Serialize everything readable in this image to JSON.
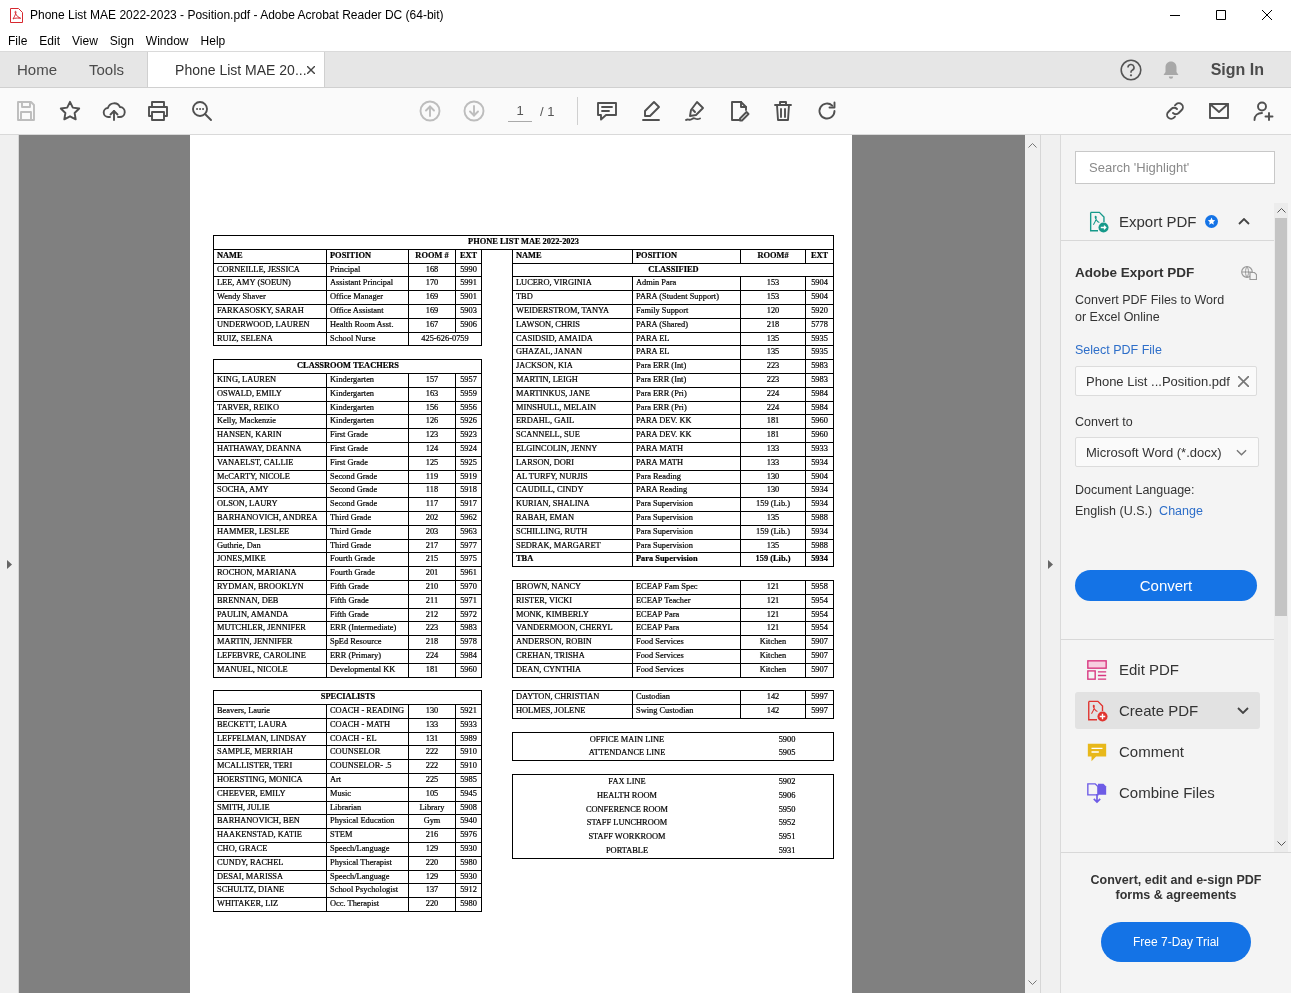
{
  "window": {
    "title": "Phone List MAE 2022-2023 - Position.pdf - Adobe Acrobat Reader DC (64-bit)"
  },
  "menu": [
    "File",
    "Edit",
    "View",
    "Sign",
    "Window",
    "Help"
  ],
  "tabs": [
    {
      "label": "Home",
      "kind": "nav",
      "selected": false
    },
    {
      "label": "Tools",
      "kind": "nav",
      "selected": false
    },
    {
      "label": "Phone List MAE 20...",
      "kind": "document",
      "selected": true
    }
  ],
  "account": {
    "label": "Sign In"
  },
  "toolbar": {
    "file_tools": [
      {
        "kind": "save",
        "disabled": true
      },
      {
        "kind": "star",
        "disabled": false
      },
      {
        "kind": "upload",
        "disabled": false
      },
      {
        "kind": "print",
        "disabled": false
      },
      {
        "kind": "zoom",
        "disabled": false
      }
    ],
    "page_nav": [
      {
        "kind": "up",
        "disabled": true
      },
      {
        "kind": "down",
        "disabled": true
      }
    ],
    "page_number": "1",
    "page_total": "/ 1",
    "edit_tools": [
      {
        "kind": "comment",
        "disabled": false
      },
      {
        "kind": "highlight",
        "disabled": false
      },
      {
        "kind": "sign",
        "disabled": false
      },
      {
        "kind": "fill",
        "disabled": false
      },
      {
        "kind": "trash",
        "disabled": false
      },
      {
        "kind": "rotate",
        "disabled": false
      }
    ],
    "share_tools": [
      {
        "kind": "link",
        "disabled": false
      },
      {
        "kind": "mail",
        "disabled": false
      },
      {
        "kind": "person",
        "disabled": false
      }
    ]
  },
  "document": {
    "title": "PHONE LIST MAE 2022-2023",
    "left": [
      {
        "kind": "table",
        "columns": [
          "NAME",
          "POSITION",
          "ROOM #",
          "EXT"
        ],
        "rows": [
          {
            "name": "CORNEILLE, JESSICA",
            "position": "Principal",
            "room": "168",
            "ext": "5990"
          },
          {
            "name": "LEE, AMY (SOEUN)",
            "position": "Assistant Principal",
            "room": "170",
            "ext": "5991"
          },
          {
            "name": "Wendy Shaver",
            "position": "Office Manager",
            "room": "169",
            "ext": "5901"
          },
          {
            "name": "FARKASOSKY, SARAH",
            "position": "Office Assistant",
            "room": "169",
            "ext": "5903"
          },
          {
            "name": "UNDERWOOD, LAUREN",
            "position": "Health Room Asst.",
            "room": "167",
            "ext": "5906"
          },
          {
            "name": "RUIZ, SELENA",
            "position": "School Nurse",
            "phone": "425-626-0759"
          }
        ]
      },
      {
        "kind": "table",
        "heading": "CLASSROOM TEACHERS",
        "rows": [
          {
            "name": "KING, LAUREN",
            "position": "Kindergarten",
            "room": "157",
            "ext": "5957"
          },
          {
            "name": "OSWALD, EMILY",
            "position": "Kindergarten",
            "room": "163",
            "ext": "5959"
          },
          {
            "name": "TARVER, REIKO",
            "position": "Kindergarten",
            "room": "156",
            "ext": "5956"
          },
          {
            "name": "Kelly, Mackenzie",
            "position": "Kindergarten",
            "room": "126",
            "ext": "5926"
          },
          {
            "name": "HANSEN, KARIN",
            "position": "First Grade",
            "room": "123",
            "ext": "5923"
          },
          {
            "name": "HATHAWAY, DEANNA",
            "position": "First Grade",
            "room": "124",
            "ext": "5924"
          },
          {
            "name": "VANAELST, CALLIE",
            "position": "First Grade",
            "room": "125",
            "ext": "5925"
          },
          {
            "name": "McCARTY, NICOLE",
            "position": "Second Grade",
            "room": "119",
            "ext": "5919"
          },
          {
            "name": "SOCHA, AMY",
            "position": "Second Grade",
            "room": "118",
            "ext": "5918"
          },
          {
            "name": "OLSON, LAURY",
            "position": "Second Grade",
            "room": "117",
            "ext": "5917"
          },
          {
            "name": "BARHANOVICH, ANDREA",
            "position": "Third Grade",
            "room": "202",
            "ext": "5962"
          },
          {
            "name": "HAMMER, LESLEE",
            "position": "Third Grade",
            "room": "203",
            "ext": "5963"
          },
          {
            "name": "Guthrie, Dan",
            "position": "Third Grade",
            "room": "217",
            "ext": "5977"
          },
          {
            "name": "JONES,MIKE",
            "position": "Fourth Grade",
            "room": "215",
            "ext": "5975"
          },
          {
            "name": "ROCHON, MARIANA",
            "position": "Fourth Grade",
            "room": "201",
            "ext": "5961"
          },
          {
            "name": "RYDMAN, BROOKLYN",
            "position": "Fifth Grade",
            "room": "210",
            "ext": "5970"
          },
          {
            "name": "BRENNAN, DEB",
            "position": "Fifth Grade",
            "room": "211",
            "ext": "5971"
          },
          {
            "name": "PAULIN, AMANDA",
            "position": "Fifth Grade",
            "room": "212",
            "ext": "5972"
          },
          {
            "name": "MUTCHLER, JENNIFER",
            "position": "ERR (Intermediate)",
            "room": "223",
            "ext": "5983"
          },
          {
            "name": "MARTIN, JENNIFER",
            "position": "SpEd Resource",
            "room": "218",
            "ext": "5978"
          },
          {
            "name": "LEFEBVRE, CAROLINE",
            "position": "ERR (Primary)",
            "room": "224",
            "ext": "5984"
          },
          {
            "name": "MANUEL, NICOLE",
            "position": "Developmental KK",
            "room": "181",
            "ext": "5960"
          }
        ]
      },
      {
        "kind": "table",
        "heading": "SPECIALISTS",
        "rows": [
          {
            "name": "Beavers, Laurie",
            "position": "COACH - READING",
            "room": "130",
            "ext": "5921"
          },
          {
            "name": "BECKETT, LAURA",
            "position": "COACH - MATH",
            "room": "133",
            "ext": "5933"
          },
          {
            "name": "LEFFELMAN, LINDSAY",
            "position": "COACH - EL",
            "room": "131",
            "ext": "5989"
          },
          {
            "name": "SAMPLE, MERRIAH",
            "position": "COUNSELOR",
            "room": "222",
            "ext": "5910"
          },
          {
            "name": "MCALLISTER, TERI",
            "position": "COUNSELOR- .5",
            "room": "222",
            "ext": "5910"
          },
          {
            "name": "HOERSTING, MONICA",
            "position": "Art",
            "room": "225",
            "ext": "5985"
          },
          {
            "name": "CHEEVER, EMILY",
            "position": "Music",
            "room": "105",
            "ext": "5945"
          },
          {
            "name": "SMITH, JULIE",
            "position": "Librarian",
            "room": "Library",
            "ext": "5908"
          },
          {
            "name": "BARHANOVICH, BEN",
            "position": "Physical Education",
            "room": "Gym",
            "ext": "5940"
          },
          {
            "name": "HAAKENSTAD, KATIE",
            "position": "STEM",
            "room": "216",
            "ext": "5976"
          },
          {
            "name": "CHO, GRACE",
            "position": "Speech/Language",
            "room": "129",
            "ext": "5930"
          },
          {
            "name": "CUNDY, RACHEL",
            "position": "Physical Therapist",
            "room": "220",
            "ext": "5980"
          },
          {
            "name": "DESAI, MARISSA",
            "position": "Speech/Language",
            "room": "129",
            "ext": "5930"
          },
          {
            "name": "SCHULTZ, DIANE",
            "position": "School Psychologist",
            "room": "137",
            "ext": "5912"
          },
          {
            "name": "WHITAKER, LIZ",
            "position": "Occ. Therapist",
            "room": "220",
            "ext": "5980"
          }
        ]
      }
    ],
    "right": [
      {
        "kind": "table",
        "columns": [
          "NAME",
          "POSITION",
          "ROOM#",
          "EXT"
        ],
        "heading": "CLASSIFIED",
        "rows": [
          {
            "name": "LUCERO, VIRGINIA",
            "position": "Admin Para",
            "room": "153",
            "ext": "5904"
          },
          {
            "name": "TBD",
            "position": "PARA (Student Support)",
            "room": "153",
            "ext": "5904"
          },
          {
            "name": "WEIDERSTROM, TANYA",
            "position": "Family Support",
            "room": "120",
            "ext": "5920"
          },
          {
            "name": "LAWSON, CHRIS",
            "position": "PARA (Shared)",
            "room": "218",
            "ext": "5778"
          },
          {
            "name": "CASIDSID, AMAIDA",
            "position": "PARA EL",
            "room": "135",
            "ext": "5935"
          },
          {
            "name": "GHAZAL, JANAN",
            "position": "PARA EL",
            "room": "135",
            "ext": "5935"
          },
          {
            "name": "JACKSON, KIA",
            "position": "Para ERR (Int)",
            "room": "223",
            "ext": "5983"
          },
          {
            "name": "MARTIN, LEIGH",
            "position": "Para ERR (Int)",
            "room": "223",
            "ext": "5983"
          },
          {
            "name": "MARTINKUS, JANE",
            "position": "Para ERR (Pri)",
            "room": "224",
            "ext": "5984"
          },
          {
            "name": "MINSHULL, MELAIN",
            "position": "Para ERR (Pri)",
            "room": "224",
            "ext": "5984"
          },
          {
            "name": "ERDAHL, GAIL",
            "position": "PARA DEV. KK",
            "room": "181",
            "ext": "5960"
          },
          {
            "name": "SCANNELL, SUE",
            "position": "PARA DEV. KK",
            "room": "181",
            "ext": "5960"
          },
          {
            "name": "ELGINCOLIN, JENNY",
            "position": "PARA MATH",
            "room": "133",
            "ext": "5933"
          },
          {
            "name": "LARSON, DORI",
            "position": "PARA MATH",
            "room": "133",
            "ext": "5934"
          },
          {
            "name": "AL TURFY, NURJIS",
            "position": "Para Reading",
            "room": "130",
            "ext": "5904"
          },
          {
            "name": "CAUDILL, CINDY",
            "position": "PARA Reading",
            "room": "130",
            "ext": "5934"
          },
          {
            "name": "KURIAN, SHALINA",
            "position": "Para Supervision",
            "room": "159 (Lib.)",
            "ext": "5934"
          },
          {
            "name": "RABAH, EMAN",
            "position": "Para Supervision",
            "room": "135",
            "ext": "5988"
          },
          {
            "name": "SCHILLING, RUTH",
            "position": "Para Supervision",
            "room": "159 (Lib.)",
            "ext": "5934"
          },
          {
            "name": "SEDRAK, MARGARET",
            "position": "Para Supervision",
            "room": "135",
            "ext": "5988"
          }
        ],
        "bold_row": {
          "name": "TBA",
          "position": "Para Supervision",
          "room": "159 (Lib.)",
          "ext": "5934"
        }
      },
      {
        "kind": "table",
        "rows": [
          {
            "name": "BROWN, NANCY",
            "position": "ECEAP Fam Spec",
            "room": "121",
            "ext": "5958"
          },
          {
            "name": "RISTER, VICKI",
            "position": "ECEAP Teacher",
            "room": "121",
            "ext": "5954"
          },
          {
            "name": "MONK, KIMBERLY",
            "position": "ECEAP Para",
            "room": "121",
            "ext": "5954"
          },
          {
            "name": "VANDERMOON, CHERYL",
            "position": "ECEAP Para",
            "room": "121",
            "ext": "5954"
          },
          {
            "name": "ANDERSON, ROBIN",
            "position": "Food Services",
            "room": "Kitchen",
            "ext": "5907"
          },
          {
            "name": "CREHAN, TRISHA",
            "position": "Food Services",
            "room": "Kitchen",
            "ext": "5907"
          },
          {
            "name": "DEAN, CYNTHIA",
            "position": "Food Services",
            "room": "Kitchen",
            "ext": "5907"
          }
        ]
      },
      {
        "kind": "table",
        "rows": [
          {
            "name": "DAYTON, CHRISTIAN",
            "position": "Custodian",
            "room": "142",
            "ext": "5997"
          },
          {
            "name": "HOLMES, JOLENE",
            "position": "Swing Custodian",
            "room": "142",
            "ext": "5997"
          }
        ]
      },
      {
        "kind": "lines",
        "rows": [
          {
            "label": "OFFICE MAIN LINE",
            "ext": "5900"
          },
          {
            "label": "ATTENDANCE LINE",
            "ext": "5905"
          }
        ]
      },
      {
        "kind": "lines",
        "rows": [
          {
            "label": "FAX LINE",
            "ext": "5902"
          },
          {
            "label": "HEALTH ROOM",
            "ext": "5906"
          },
          {
            "label": "CONFERENCE ROOM",
            "ext": "5950"
          },
          {
            "label": "STAFF LUNCHROOM",
            "ext": "5952"
          },
          {
            "label": "STAFF WORKROOM",
            "ext": "5951"
          },
          {
            "label": "PORTABLE",
            "ext": "5931"
          }
        ]
      }
    ]
  },
  "side_panel": {
    "search": {
      "placeholder": "Search 'Highlight'"
    },
    "export": {
      "title": "Export PDF",
      "expanded": true,
      "heading": "Adobe Export PDF",
      "description": "Convert PDF Files to Word or Excel Online",
      "file_label": "Select PDF File",
      "file": "Phone List ...Position.pdf",
      "format_label": "Convert to",
      "format": "Microsoft Word (*.docx)",
      "language_label": "Document Language:",
      "language": "English (U.S.)",
      "language_link": "Change",
      "button": "Convert"
    },
    "tools": [
      {
        "kind": "edit",
        "label": "Edit PDF",
        "expandable": false,
        "hovered": false
      },
      {
        "kind": "create",
        "label": "Create PDF",
        "expandable": true,
        "hovered": true
      },
      {
        "kind": "comment",
        "label": "Comment",
        "expandable": false,
        "hovered": false
      },
      {
        "kind": "combine",
        "label": "Combine Files",
        "expandable": false,
        "hovered": false
      }
    ],
    "promo": {
      "text": "Convert, edit and e-sign PDF forms & agreements",
      "button": "Free 7-Day Trial"
    }
  }
}
